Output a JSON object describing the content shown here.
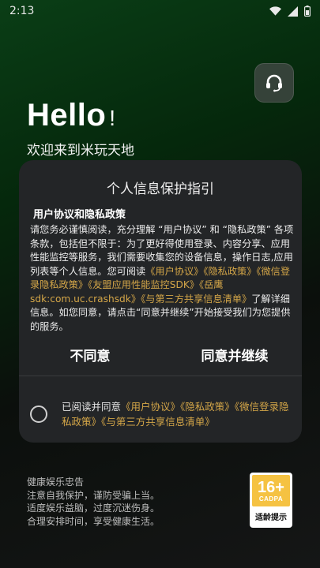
{
  "status_bar": {
    "time": "2:13"
  },
  "hello": {
    "title": "Hello",
    "exclaim": "!",
    "welcome": "欢迎来到米玩天地"
  },
  "dialog": {
    "title": "个人信息保护指引",
    "subtitle": "用户协议和隐私政策",
    "body_part1": "请您务必谨慎阅读，充分理解 “用户协议” 和 “隐私政策” 各项条款，包括但不限于：为了更好得使用登录、内容分享、应用性能监控等服务，我们需要收集您的设备信息，操作日志,应用列表等个人信息。您可阅读",
    "link_user": "《用户协议》",
    "link_privacy": "《隐私政策》",
    "link_wechat": "《微信登录隐私政策》",
    "link_apm": "《友盟应用性能监控SDK》",
    "link_yueying": "《岳鹰sdk:com.uc.crashsdk》",
    "link_share": "《与第三方共享信息清单》",
    "body_part2": "了解详细信息。如您同意，请点击“同意并继续”开始接受我们为您提供的服务。",
    "disagree": "不同意",
    "agree": "同意并继续",
    "consent_prefix": "已阅读并同意",
    "consent_user": "《用户协议》",
    "consent_privacy": "《隐私政策》",
    "consent_wechat": "《微信登录隐私政策》",
    "consent_share": "《与第三方共享信息清单》"
  },
  "health_notice": {
    "title": "健康娱乐忠告",
    "line1": "注意自我保护，谨防受骗上当。",
    "line2": "适度娱乐益脑，过度沉迷伤身。",
    "line3": "合理安排时间，享受健康生活。"
  },
  "age_rating": {
    "age": "16+",
    "org": "CADPA",
    "label": "适龄提示"
  },
  "colors": {
    "link": "#d4a648",
    "dialog_bg": "#232527",
    "badge_yellow": "#f5c242"
  },
  "icons": {
    "support": "headset-icon",
    "wifi": "wifi-icon",
    "signal": "signal-icon",
    "battery": "battery-icon"
  }
}
